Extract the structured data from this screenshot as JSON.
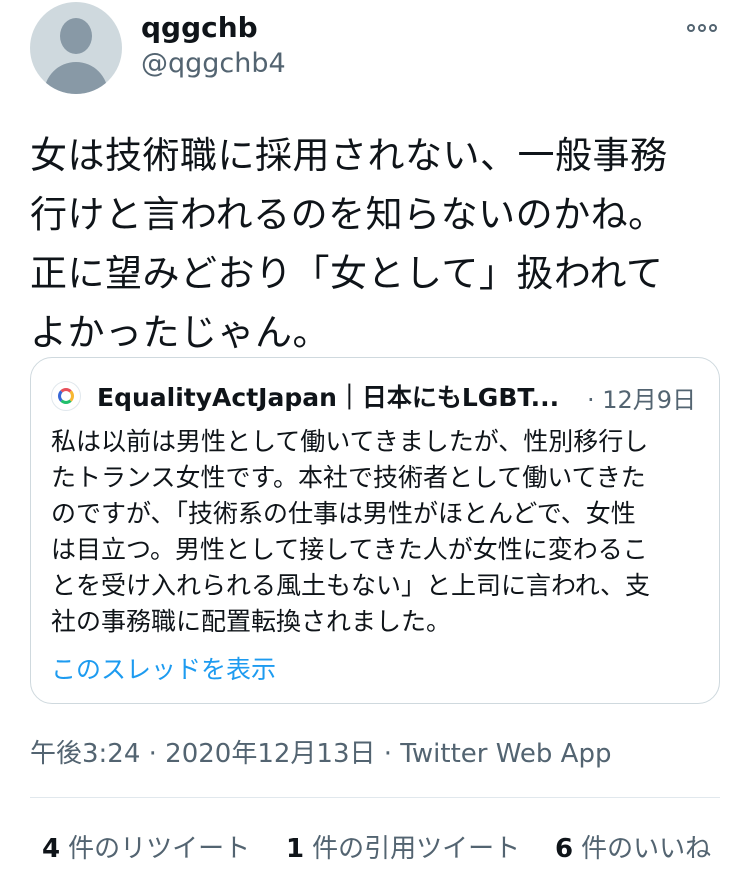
{
  "author": {
    "display_name": "qggchb",
    "handle": "@qggchb4",
    "avatar_icon": "default-person-icon",
    "more_icon": "more-horizontal-icon"
  },
  "tweet": {
    "text": "女は技術職に採用されない、一般事務\n行けと言われるのを知らないのかね。\n正に望みどおり「女として」扱われて\nよかったじゃん。"
  },
  "quote": {
    "author_name": "EqualityActJapan｜日本にもLGBT...",
    "date": "· 12月9日",
    "text": "私は以前は男性として働いてきましたが、性別移行し\nたトランス女性です。本社で技術者として働いてきた\nのですが、「技術系の仕事は男性がほとんどで、女性\nは目立つ。男性として接してきた人が女性に変わるこ\nとを受け入れられる風土もない」と上司に言われ、支\n社の事務職に配置転換されました。",
    "show_thread": "このスレッドを表示"
  },
  "meta": {
    "timestamp": "午後3:24 · 2020年12月13日 · Twitter Web App"
  },
  "stats": {
    "retweets_count": "4",
    "retweets_label": "件のリツイート",
    "quotes_count": "1",
    "quotes_label": "件の引用ツイート",
    "likes_count": "6",
    "likes_label": "件のいいね"
  },
  "colors": {
    "link": "#1d9bf0",
    "secondary_text": "#536471",
    "border": "#cfd9de"
  }
}
